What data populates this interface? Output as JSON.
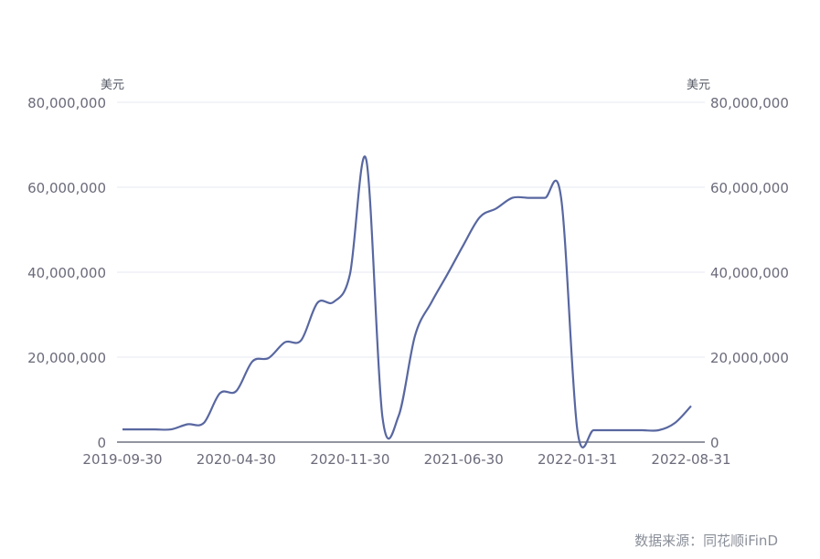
{
  "chart_data": {
    "type": "line",
    "y_unit_left": "美元",
    "y_unit_right": "美元",
    "ylim": [
      0,
      80000000
    ],
    "yticks": [
      0,
      20000000,
      40000000,
      60000000,
      80000000
    ],
    "ytick_labels": [
      "0",
      "20,000,000",
      "40,000,000",
      "60,000,000",
      "80,000,000"
    ],
    "xtick_labels": [
      "2019-09-30",
      "2020-04-30",
      "2020-11-30",
      "2021-06-30",
      "2022-01-31",
      "2022-08-31"
    ],
    "grid": true,
    "series": [
      {
        "color": "#5867a0",
        "x": [
          "2019-09-30",
          "2019-10-31",
          "2019-11-30",
          "2019-12-31",
          "2020-01-31",
          "2020-02-29",
          "2020-03-31",
          "2020-04-30",
          "2020-05-31",
          "2020-06-30",
          "2020-07-31",
          "2020-08-31",
          "2020-09-30",
          "2020-10-31",
          "2020-11-30",
          "2020-12-31",
          "2021-01-31",
          "2021-02-28",
          "2021-03-31",
          "2021-04-30",
          "2021-05-31",
          "2021-06-30",
          "2021-07-31",
          "2021-08-31",
          "2021-09-30",
          "2021-10-31",
          "2021-11-30",
          "2021-12-31",
          "2022-01-31",
          "2022-02-28",
          "2022-03-31",
          "2022-04-30",
          "2022-05-31",
          "2022-06-30",
          "2022-07-31",
          "2022-08-31"
        ],
        "values": [
          3000000,
          3000000,
          3000000,
          3000000,
          4200000,
          4500000,
          11500000,
          12000000,
          19000000,
          19800000,
          23500000,
          24000000,
          32800000,
          33000000,
          39500000,
          66500000,
          6000000,
          6200000,
          25000000,
          32800000,
          39500000,
          46500000,
          53000000,
          55000000,
          57500000,
          57500000,
          57500000,
          57500000,
          2800000,
          2800000,
          2800000,
          2800000,
          2800000,
          2800000,
          4500000,
          8500000
        ]
      }
    ]
  },
  "footer": {
    "source": "数据来源：同花顺iFinD"
  }
}
